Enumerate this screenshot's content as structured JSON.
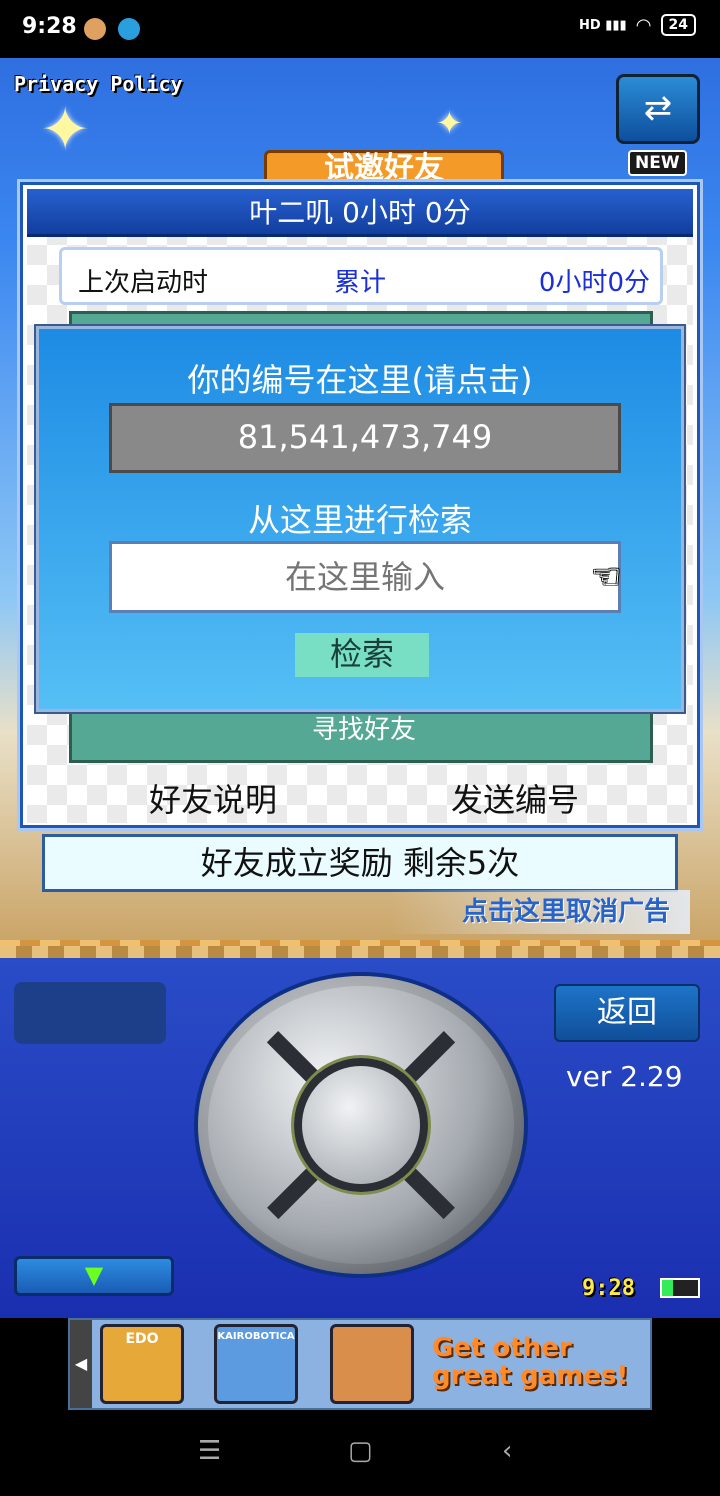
{
  "status_bar": {
    "time": "9:28",
    "signal": "HD",
    "battery": "24"
  },
  "game": {
    "privacy_label": "Privacy Policy",
    "new_badge": "NEW",
    "banner_text": "试邀好友",
    "friend_panel": {
      "header": "叶二叽  0小时 0分",
      "stats": {
        "last_start_label": "上次启动时",
        "total_label": "累计",
        "total_value": "0小时0分"
      },
      "find_friend_label": "寻找好友",
      "explain_button": "好友说明",
      "send_id_button": "发送编号"
    },
    "reward_bar": "好友成立奖励  剩余5次",
    "ad_cancel_link": "点击这里取消广告",
    "search_dialog": {
      "title": "你的编号在这里(请点击)",
      "id_value": "81,541,473,749",
      "search_label": "从这里进行检索",
      "input_placeholder": "在这里输入",
      "search_button": "检索"
    },
    "back_button": "返回",
    "version": "ver 2.29",
    "clock": "9:28",
    "menu_arrow": "▼"
  },
  "ads": {
    "games": [
      {
        "label": "EDO",
        "color": "#e7a83a"
      },
      {
        "label": "KAIROBOTICA",
        "color": "#5d9be0"
      },
      {
        "label": "",
        "color": "#d98f4b"
      }
    ],
    "promo_line1": "Get other",
    "promo_line2": "great games!"
  },
  "icons": {
    "hand": "pointing-hand-icon",
    "dpad": "dpad-icon",
    "swap": "swap-icon"
  }
}
